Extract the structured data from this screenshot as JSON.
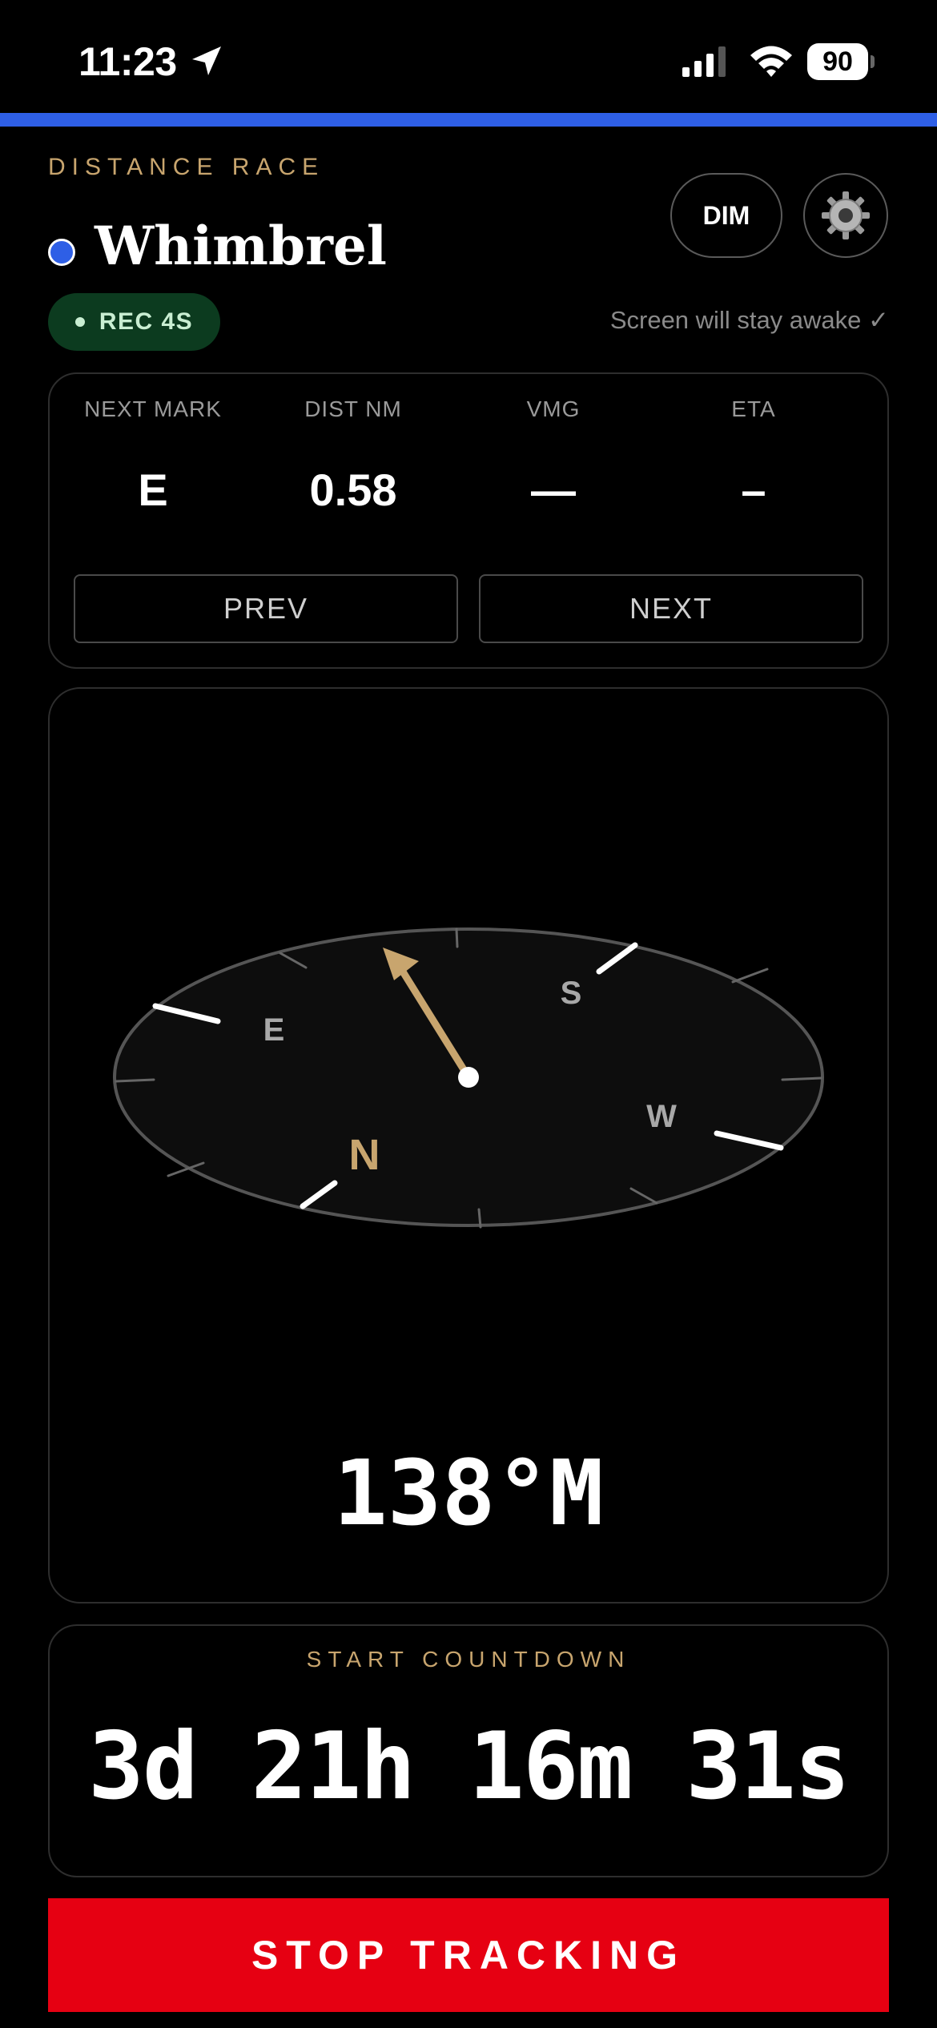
{
  "status_bar": {
    "time": "11:23",
    "battery": "90"
  },
  "header": {
    "race_type": "DISTANCE RACE",
    "boat_name": "Whimbrel",
    "dim_label": "DIM",
    "rec_label": "REC 4S",
    "awake_text": "Screen will stay awake ✓"
  },
  "nav": {
    "stats": [
      {
        "label": "NEXT MARK",
        "value": "E"
      },
      {
        "label": "DIST NM",
        "value": "0.58"
      },
      {
        "label": "VMG",
        "value": "—"
      },
      {
        "label": "ETA",
        "value": "–"
      }
    ],
    "prev_label": "PREV",
    "next_label": "NEXT"
  },
  "compass": {
    "cardinals": {
      "n": "N",
      "e": "E",
      "s": "S",
      "w": "W"
    },
    "heading": "138°M"
  },
  "countdown": {
    "label": "START COUNTDOWN",
    "value": "3d 21h 16m 31s"
  },
  "stop_label": "STOP TRACKING",
  "colors": {
    "accent": "#2e5fe6",
    "gold": "#c8a56e",
    "stop": "#e60012",
    "rec_bg": "#0c3b1f"
  }
}
